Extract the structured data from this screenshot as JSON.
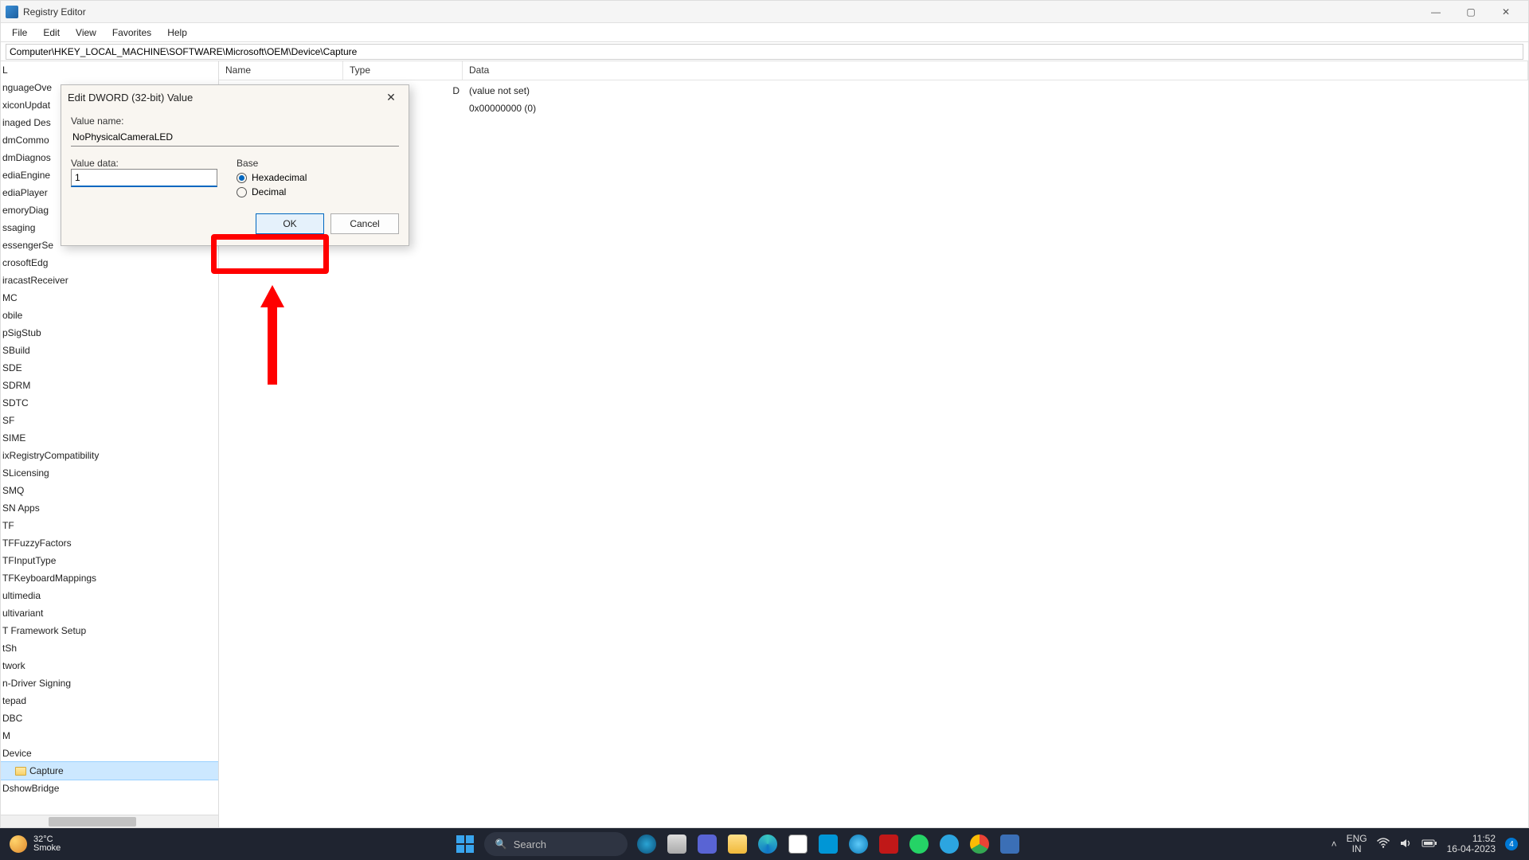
{
  "window": {
    "title": "Registry Editor",
    "minimize": "—",
    "maximize": "▢",
    "close": "✕"
  },
  "menu": {
    "file": "File",
    "edit": "Edit",
    "view": "View",
    "favorites": "Favorites",
    "help": "Help"
  },
  "address": "Computer\\HKEY_LOCAL_MACHINE\\SOFTWARE\\Microsoft\\OEM\\Device\\Capture",
  "columns": {
    "name": "Name",
    "type": "Type",
    "data": "Data"
  },
  "tree_items": [
    "L",
    "nguageOve",
    "xiconUpdat",
    "inaged Des",
    "dmCommo",
    "dmDiagnos",
    "ediaEngine",
    "ediaPlayer",
    "emoryDiag",
    "ssaging",
    "essengerSe",
    "crosoftEdg",
    "iracastReceiver",
    "MC",
    "obile",
    "pSigStub",
    "SBuild",
    "SDE",
    "SDRM",
    "SDTC",
    "SF",
    "SIME",
    "ixRegistryCompatibility",
    "SLicensing",
    "SMQ",
    "SN Apps",
    "TF",
    "TFFuzzyFactors",
    "TFInputType",
    "TFKeyboardMappings",
    "ultimedia",
    "ultivariant",
    "T Framework Setup",
    "tSh",
    "twork",
    "n-Driver Signing",
    "tepad",
    "DBC",
    "M",
    "Device",
    "Capture",
    "DshowBridge"
  ],
  "tree_selected_index": 40,
  "dword_suffix": "D",
  "list_rows": [
    {
      "data": "(value not set)"
    },
    {
      "data": "0x00000000 (0)"
    }
  ],
  "dialog": {
    "title": "Edit DWORD (32-bit) Value",
    "value_name_label": "Value name:",
    "value_name": "NoPhysicalCameraLED",
    "value_data_label": "Value data:",
    "value_data": "1",
    "base_label": "Base",
    "hex_label": "Hexadecimal",
    "dec_label": "Decimal",
    "ok": "OK",
    "cancel": "Cancel",
    "close": "✕"
  },
  "taskbar": {
    "temp": "32°C",
    "weather": "Smoke",
    "search_placeholder": "Search",
    "lang_top": "ENG",
    "lang_bottom": "IN",
    "time": "11:52",
    "date": "16-04-2023",
    "chevron": "˄",
    "notif_count": "4"
  }
}
